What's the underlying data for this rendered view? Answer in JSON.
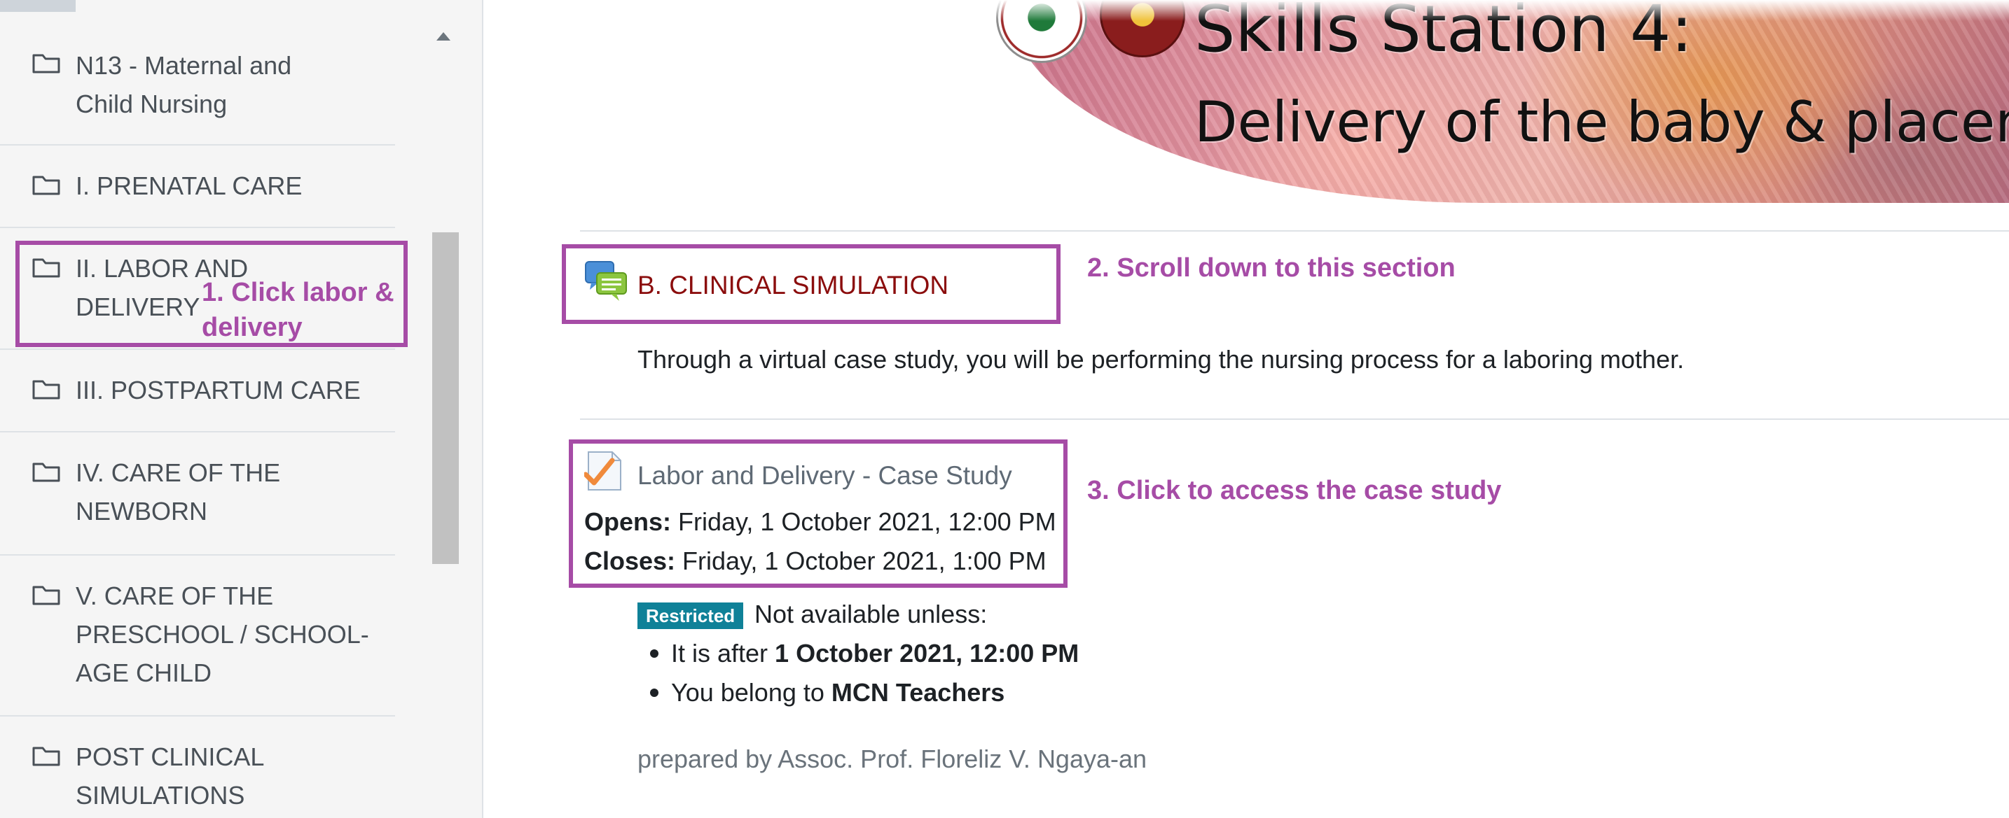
{
  "sidebar": {
    "items": [
      {
        "lines": [
          "N13 - Maternal and",
          "Child Nursing"
        ]
      },
      {
        "lines": [
          "I. PRENATAL CARE"
        ]
      },
      {
        "lines": [
          "II. LABOR AND",
          "DELIVERY"
        ]
      },
      {
        "lines": [
          "III. POSTPARTUM CARE"
        ]
      },
      {
        "lines": [
          "IV. CARE OF THE",
          "NEWBORN"
        ]
      },
      {
        "lines": [
          "V. CARE OF THE",
          "PRESCHOOL / SCHOOL-",
          "AGE CHILD"
        ]
      },
      {
        "lines": [
          "POST CLINICAL",
          "SIMULATIONS"
        ]
      }
    ]
  },
  "banner": {
    "title_line_1": "Skills Station 4:",
    "title_line_2": "Delivery of the baby & placenta"
  },
  "forum": {
    "title": "B. CLINICAL SIMULATION",
    "description": "Through a virtual case study, you will be performing the nursing process for a laboring mother."
  },
  "quiz": {
    "title": "Labor and Delivery - Case Study",
    "opens_label": "Opens:",
    "opens_value": " Friday, 1 October 2021, 12:00 PM",
    "closes_label": "Closes:",
    "closes_value": " Friday, 1 October 2021, 1:00 PM"
  },
  "restriction": {
    "badge": "Restricted",
    "intro": "Not available unless:",
    "cond1_prefix": "It is after ",
    "cond1_value": "1 October 2021, 12:00 PM",
    "cond2_prefix": "You belong to ",
    "cond2_value": "MCN Teachers"
  },
  "prepared_by": "prepared by Assoc. Prof. Floreliz V. Ngaya-an",
  "annotations": {
    "step1_line1": "1. Click labor &",
    "step1_line2": "delivery",
    "step2": "2. Scroll down to this section",
    "step3": "3. Click to access the case study"
  },
  "colors": {
    "annotation": "#a64ca6",
    "forum_link": "#8b0d0d",
    "restricted_badge": "#0f8198"
  }
}
